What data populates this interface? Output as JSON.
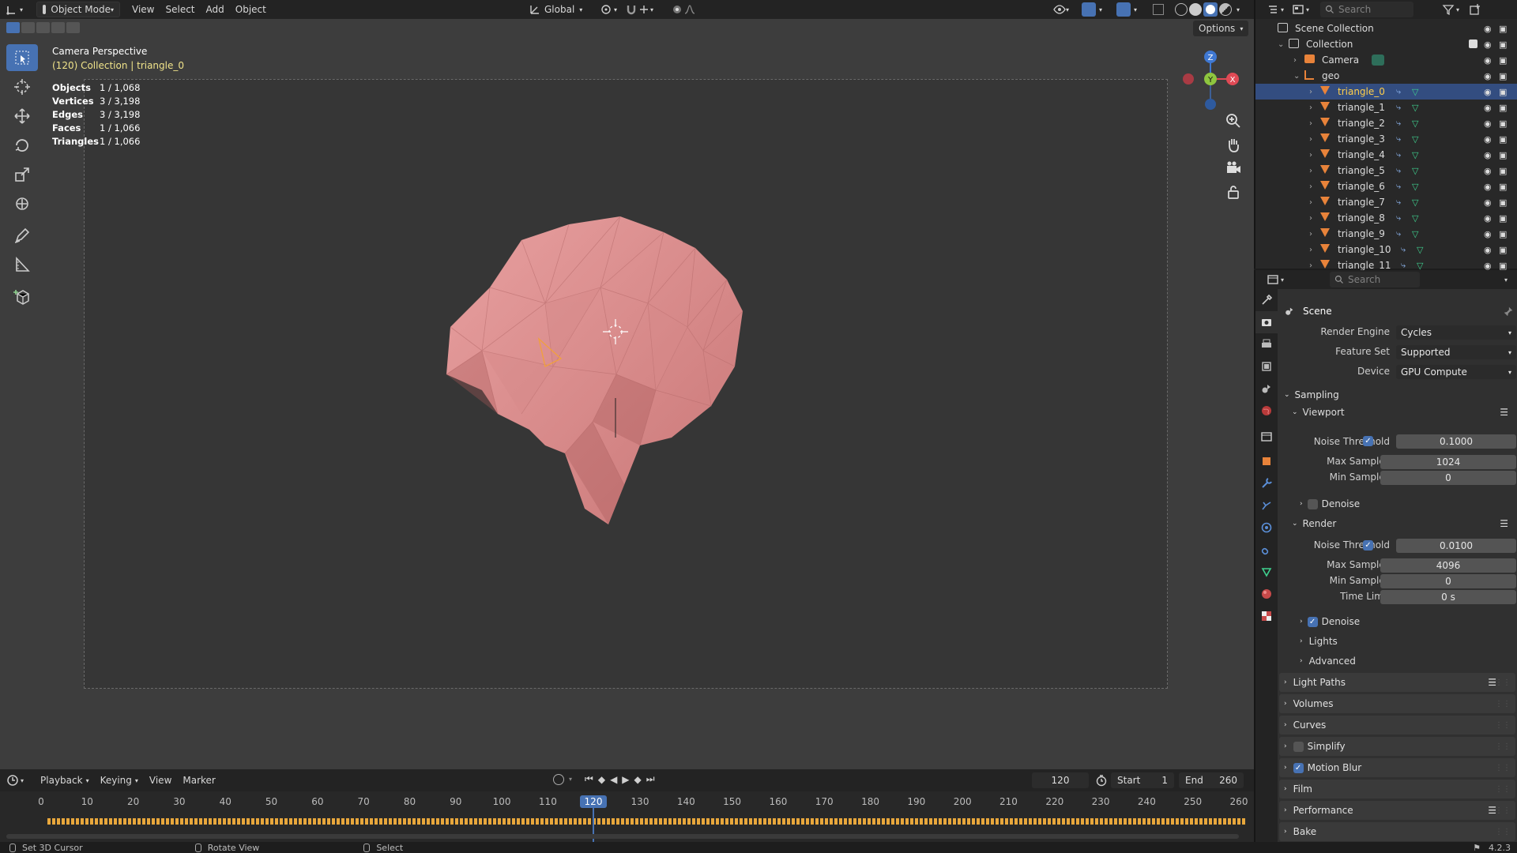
{
  "header": {
    "mode": "Object Mode",
    "menus": [
      "View",
      "Select",
      "Add",
      "Object"
    ],
    "orientation": "Global",
    "search_placeholder": "Search"
  },
  "viewport": {
    "options": "Options",
    "cam_title": "Camera Perspective",
    "cam_sub": "(120) Collection | triangle_0",
    "stats": [
      {
        "k": "Objects",
        "v": "1 / 1,068"
      },
      {
        "k": "Vertices",
        "v": "3 / 3,198"
      },
      {
        "k": "Edges",
        "v": "3 / 3,198"
      },
      {
        "k": "Faces",
        "v": "1 / 1,066"
      },
      {
        "k": "Triangles",
        "v": "1 / 1,066"
      }
    ],
    "gizmo": {
      "z": "Z",
      "y": "Y",
      "x": "X"
    }
  },
  "timeline": {
    "menus": [
      "Playback",
      "Keying",
      "View",
      "Marker"
    ],
    "current": "120",
    "start_label": "Start",
    "start": "1",
    "end_label": "End",
    "end": "260",
    "ticks": [
      "0",
      "10",
      "20",
      "30",
      "40",
      "50",
      "60",
      "70",
      "80",
      "90",
      "100",
      "110",
      "120",
      "130",
      "140",
      "150",
      "160",
      "170",
      "180",
      "190",
      "200",
      "210",
      "220",
      "230",
      "240",
      "250",
      "260"
    ]
  },
  "status": {
    "a": "Set 3D Cursor",
    "b": "Rotate View",
    "c": "Select",
    "version": "4.2.3"
  },
  "outliner": {
    "search": "Search",
    "scene": "Scene Collection",
    "collection": "Collection",
    "camera": "Camera",
    "geo": "geo",
    "items": [
      "triangle_0",
      "triangle_1",
      "triangle_2",
      "triangle_3",
      "triangle_4",
      "triangle_5",
      "triangle_6",
      "triangle_7",
      "triangle_8",
      "triangle_9",
      "triangle_10",
      "triangle_11"
    ]
  },
  "properties": {
    "search": "Search",
    "scene": "Scene",
    "engine_l": "Render Engine",
    "engine": "Cycles",
    "fs_l": "Feature Set",
    "fs": "Supported",
    "dev_l": "Device",
    "dev": "GPU Compute",
    "sampling": "Sampling",
    "viewport": "Viewport",
    "nt_l": "Noise Threshold",
    "vp_nt": "0.1000",
    "max_l": "Max Samples",
    "vp_max": "1024",
    "min_l": "Min Samples",
    "vp_min": "0",
    "denoise": "Denoise",
    "render": "Render",
    "r_nt": "0.0100",
    "r_max": "4096",
    "r_min": "0",
    "tl_l": "Time Limit",
    "r_tl": "0 s",
    "lights": "Lights",
    "advanced": "Advanced",
    "panels": [
      "Light Paths",
      "Volumes",
      "Curves",
      "Simplify",
      "Motion Blur",
      "Film",
      "Performance",
      "Bake"
    ]
  },
  "colors": {
    "accent": "#4772b3",
    "mesh": "#e8a07c",
    "keyframe": "#e8a73c",
    "selected_row": "#334d80"
  }
}
